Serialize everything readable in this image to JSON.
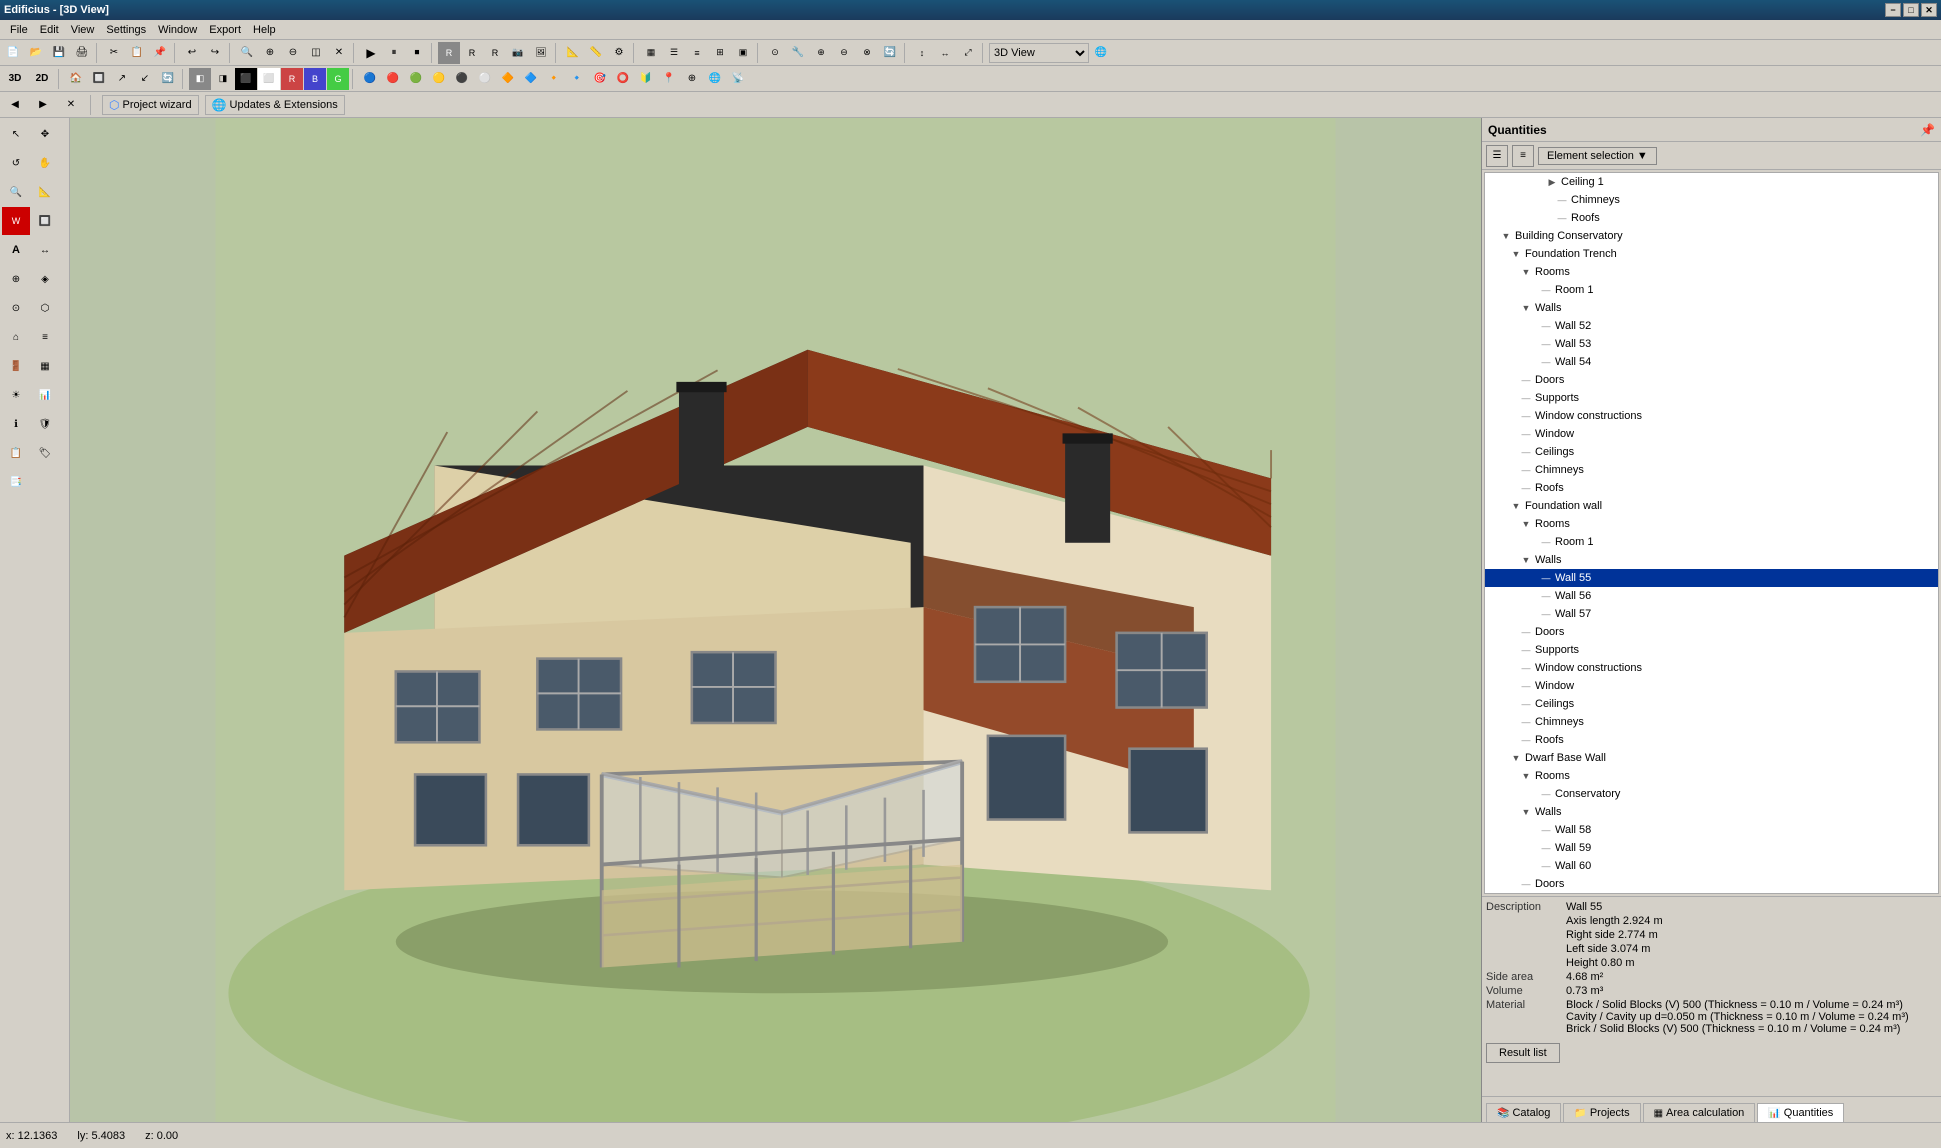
{
  "app": {
    "title": "Edificius - [3D View]",
    "min_label": "−",
    "max_label": "□",
    "close_label": "✕"
  },
  "menu": {
    "items": [
      "File",
      "Edit",
      "View",
      "Settings",
      "Window",
      "Export",
      "Help"
    ]
  },
  "toolbar1": {
    "buttons": [
      "📄",
      "📂",
      "💾",
      "🖨",
      "✂",
      "📋",
      "📌",
      "↩",
      "↪",
      "🔍",
      "⊕",
      "⊖",
      "◫",
      "✕",
      "▶",
      "⏸",
      "⏹",
      "🎞",
      "📷",
      "🖼",
      "📐",
      "📏",
      "⚙",
      "📦",
      "🔲",
      "🔳",
      "▦",
      "☰",
      "≡",
      "⊞",
      "▣",
      "⊙",
      "🔧",
      "⊕",
      "⊖",
      "⊗",
      "🔄",
      "↕",
      "↔",
      "⤢"
    ]
  },
  "toolbar2": {
    "buttons": [
      "3D",
      "2D",
      "🏠",
      "🔲",
      "↗",
      "↙",
      "🔄",
      "◧",
      "◨",
      "⬛",
      "⬜",
      "🟥",
      "🟦",
      "🟩",
      "🟨",
      "🔵",
      "🔴",
      "🟢",
      "🟡",
      "⚫",
      "⚪",
      "🔶",
      "🔷",
      "🔸",
      "🔹",
      "🎯",
      "⭕",
      "🔰",
      "📍",
      "⊕",
      "🌐",
      "📡"
    ]
  },
  "wizard": {
    "back_label": "◀",
    "forward_label": "▶",
    "stop_label": "✕",
    "project_wizard_label": "Project wizard",
    "updates_label": "Updates & Extensions"
  },
  "quantities_panel": {
    "title": "Quantities",
    "pin_label": "📌",
    "element_selection_label": "Element selection",
    "dropdown_label": "▼"
  },
  "tree": {
    "items": [
      {
        "id": "ceiling1",
        "label": "Ceiling 1",
        "level": 3,
        "expanded": false,
        "selected": false
      },
      {
        "id": "chimneys1",
        "label": "Chimneys",
        "level": 4,
        "expanded": false,
        "selected": false
      },
      {
        "id": "roofs1",
        "label": "Roofs",
        "level": 4,
        "expanded": false,
        "selected": false
      },
      {
        "id": "building-conservatory",
        "label": "Building Conservatory",
        "level": 1,
        "expanded": true,
        "selected": false
      },
      {
        "id": "foundation-trench",
        "label": "Foundation Trench",
        "level": 2,
        "expanded": true,
        "selected": false
      },
      {
        "id": "rooms-ft",
        "label": "Rooms",
        "level": 3,
        "expanded": true,
        "selected": false
      },
      {
        "id": "room1-ft",
        "label": "Room 1",
        "level": 4,
        "expanded": false,
        "selected": false
      },
      {
        "id": "walls-ft",
        "label": "Walls",
        "level": 3,
        "expanded": true,
        "selected": false
      },
      {
        "id": "wall52",
        "label": "Wall 52",
        "level": 4,
        "expanded": false,
        "selected": false
      },
      {
        "id": "wall53",
        "label": "Wall 53",
        "level": 4,
        "expanded": false,
        "selected": false
      },
      {
        "id": "wall54",
        "label": "Wall 54",
        "level": 4,
        "expanded": false,
        "selected": false
      },
      {
        "id": "doors-ft",
        "label": "Doors",
        "level": 3,
        "expanded": false,
        "selected": false
      },
      {
        "id": "supports-ft",
        "label": "Supports",
        "level": 3,
        "expanded": false,
        "selected": false
      },
      {
        "id": "window-constructions-ft",
        "label": "Window constructions",
        "level": 3,
        "expanded": false,
        "selected": false
      },
      {
        "id": "window-ft",
        "label": "Window",
        "level": 3,
        "expanded": false,
        "selected": false
      },
      {
        "id": "ceilings-ft",
        "label": "Ceilings",
        "level": 3,
        "expanded": false,
        "selected": false
      },
      {
        "id": "chimneys-ft",
        "label": "Chimneys",
        "level": 3,
        "expanded": false,
        "selected": false
      },
      {
        "id": "roofs-ft",
        "label": "Roofs",
        "level": 3,
        "expanded": false,
        "selected": false
      },
      {
        "id": "foundation-wall",
        "label": "Foundation wall",
        "level": 2,
        "expanded": true,
        "selected": false
      },
      {
        "id": "rooms-fw",
        "label": "Rooms",
        "level": 3,
        "expanded": true,
        "selected": false
      },
      {
        "id": "room1-fw",
        "label": "Room 1",
        "level": 4,
        "expanded": false,
        "selected": false
      },
      {
        "id": "walls-fw",
        "label": "Walls",
        "level": 3,
        "expanded": true,
        "selected": false
      },
      {
        "id": "wall55",
        "label": "Wall 55",
        "level": 4,
        "expanded": false,
        "selected": true,
        "highlight": true
      },
      {
        "id": "wall56",
        "label": "Wall 56",
        "level": 4,
        "expanded": false,
        "selected": false
      },
      {
        "id": "wall57",
        "label": "Wall 57",
        "level": 4,
        "expanded": false,
        "selected": false
      },
      {
        "id": "doors-fw",
        "label": "Doors",
        "level": 3,
        "expanded": false,
        "selected": false
      },
      {
        "id": "supports-fw",
        "label": "Supports",
        "level": 3,
        "expanded": false,
        "selected": false
      },
      {
        "id": "window-constructions-fw",
        "label": "Window constructions",
        "level": 3,
        "expanded": false,
        "selected": false
      },
      {
        "id": "window-fw",
        "label": "Window",
        "level": 3,
        "expanded": false,
        "selected": false
      },
      {
        "id": "ceilings-fw",
        "label": "Ceilings",
        "level": 3,
        "expanded": false,
        "selected": false
      },
      {
        "id": "chimneys-fw",
        "label": "Chimneys",
        "level": 3,
        "expanded": false,
        "selected": false
      },
      {
        "id": "roofs-fw",
        "label": "Roofs",
        "level": 3,
        "expanded": false,
        "selected": false
      },
      {
        "id": "dwarf-base-wall",
        "label": "Dwarf Base Wall",
        "level": 2,
        "expanded": true,
        "selected": false
      },
      {
        "id": "rooms-dbw",
        "label": "Rooms",
        "level": 3,
        "expanded": true,
        "selected": false
      },
      {
        "id": "conservatory",
        "label": "Conservatory",
        "level": 4,
        "expanded": false,
        "selected": false
      },
      {
        "id": "walls-dbw",
        "label": "Walls",
        "level": 3,
        "expanded": true,
        "selected": false
      },
      {
        "id": "wall58",
        "label": "Wall 58",
        "level": 4,
        "expanded": false,
        "selected": false
      },
      {
        "id": "wall59",
        "label": "Wall 59",
        "level": 4,
        "expanded": false,
        "selected": false
      },
      {
        "id": "wall60",
        "label": "Wall 60",
        "level": 4,
        "expanded": false,
        "selected": false
      },
      {
        "id": "doors-dbw",
        "label": "Doors",
        "level": 3,
        "expanded": false,
        "selected": false
      }
    ]
  },
  "details": {
    "description_label": "Description",
    "description_value": "Wall 55",
    "axis_length_label": "Axis length",
    "axis_length_value": "2.924 m",
    "right_side_label": "Right side",
    "right_side_value": "2.774 m",
    "left_side_label": "Left side",
    "left_side_value": "3.074 m",
    "height_label": "Height",
    "height_value": "0.80 m",
    "side_area_label": "Side area",
    "side_area_value": "4.68 m²",
    "volume_label": "Volume",
    "volume_value": "0.73 m³",
    "material_label": "Material",
    "material_line1": "Block / Solid Blocks (V) 500 (Thickness = 0.10 m / Volume = 0.24 m³)",
    "material_line2": "Cavity / Cavity up d=0.050 m (Thickness = 0.10 m / Volume = 0.24 m³)",
    "material_line3": "Brick / Solid Blocks (V) 500 (Thickness = 0.10 m / Volume = 0.24 m³)",
    "result_list_label": "Result list"
  },
  "bottom_tabs": {
    "catalog_label": "Catalog",
    "projects_label": "Projects",
    "area_calculation_label": "Area calculation",
    "quantities_label": "Quantities"
  },
  "status_bar": {
    "x_label": "x:",
    "x_value": "12.1363",
    "y_label": "ly:",
    "y_value": "5.4083",
    "z_label": "z:",
    "z_value": "0.00"
  }
}
